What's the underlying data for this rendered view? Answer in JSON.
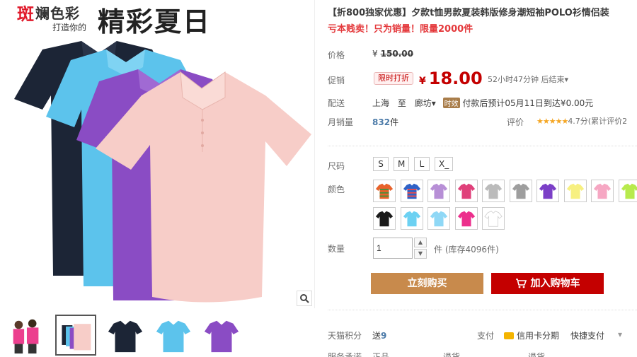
{
  "banner": {
    "brand_first": "斑",
    "brand_rest": "斓色彩",
    "sub": "打造你的",
    "headline": "精彩夏日"
  },
  "product": {
    "title": "【折800独家优惠】夕款t恤男款夏装韩版修身潮短袖POLO衫情侣装",
    "subtitle": "亏本贱卖！只为销量！限量2000件"
  },
  "price": {
    "label": "价格",
    "currency": "¥",
    "original": "150.00",
    "promo_label": "促销",
    "promo_tag": "限时打折",
    "current": "18.00",
    "countdown": "52小时47分钟 后结束",
    "countdown_arrow": "▾"
  },
  "shipping": {
    "label": "配送",
    "from": "上海",
    "to_word": "至",
    "dest": "廊坊",
    "dest_arrow": "▾",
    "tag": "时效",
    "text": "付款后预计05月11日到达¥0.00元"
  },
  "sales": {
    "label": "月销量",
    "count": "832",
    "unit": "件",
    "review_label": "评价",
    "stars": "★★★★★",
    "score_text": "4.7分(累计评价2"
  },
  "size": {
    "label": "尺码",
    "options": [
      "S",
      "M",
      "L",
      "X_"
    ]
  },
  "color": {
    "label": "颜色",
    "swatches": [
      {
        "name": "stripe-rainbow",
        "body": "#e8622b",
        "stripe": "#4a8f3a"
      },
      {
        "name": "stripe-blue",
        "body": "#2f62c7",
        "stripe": "#e84b4b"
      },
      {
        "name": "lilac",
        "body": "#b78fd6",
        "stripe": ""
      },
      {
        "name": "pink-red",
        "body": "#e0407a",
        "stripe": ""
      },
      {
        "name": "gray-white",
        "body": "#bbbbbb",
        "stripe": ""
      },
      {
        "name": "gray",
        "body": "#9e9e9e",
        "stripe": ""
      },
      {
        "name": "purple",
        "body": "#7b3fc7",
        "stripe": ""
      },
      {
        "name": "yellow",
        "body": "#f7f080",
        "stripe": ""
      },
      {
        "name": "pink",
        "body": "#f6a7c3",
        "stripe": ""
      },
      {
        "name": "lime",
        "body": "#b7ea4c",
        "stripe": ""
      },
      {
        "name": "black",
        "body": "#1a1a1a",
        "stripe": ""
      },
      {
        "name": "sky-blue",
        "body": "#6cd1f2",
        "stripe": ""
      },
      {
        "name": "light-blue",
        "body": "#8fd8f6",
        "stripe": ""
      },
      {
        "name": "rose",
        "body": "#ec2f8c",
        "stripe": ""
      },
      {
        "name": "white",
        "body": "#ffffff",
        "stripe": ""
      }
    ]
  },
  "quantity": {
    "label": "数量",
    "value": "1",
    "unit": "件",
    "stock": "(库存4096件)"
  },
  "actions": {
    "buy": "立刻购买",
    "cart": "加入购物车"
  },
  "footer": {
    "points_label": "天猫积分",
    "points_text": "送",
    "points_value": "9",
    "pay_label": "支付",
    "credit": "信用卡分期",
    "quick_pay": "快捷支付",
    "quick_arrow": "▾",
    "services": [
      "服务承诺",
      "正品",
      "退货",
      "退货"
    ]
  },
  "colors": {
    "accent_red": "#c40000",
    "buy_brown": "#c88a4c",
    "link_blue": "#4b7aa8"
  }
}
